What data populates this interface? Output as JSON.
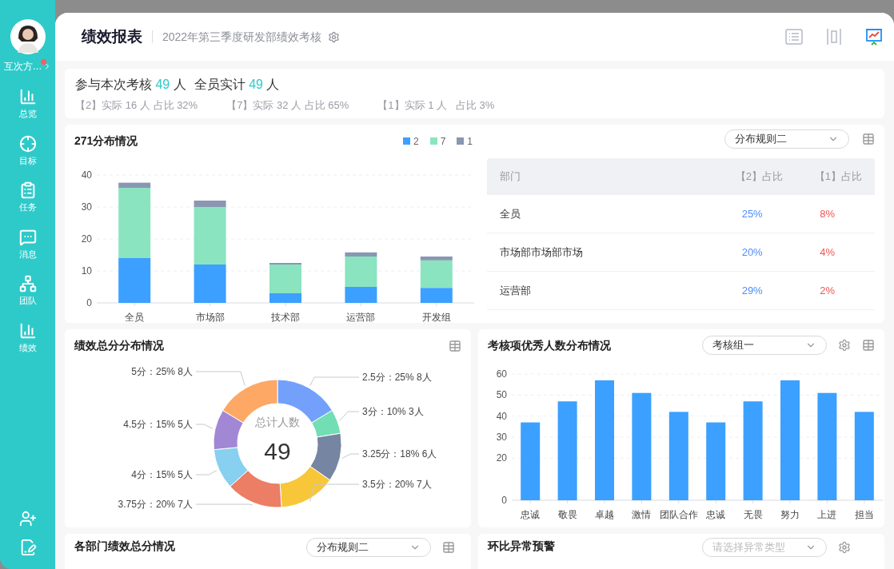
{
  "sidebar": {
    "user": {
      "name": "互次方…",
      "unread": true
    },
    "items": [
      {
        "label": "总览"
      },
      {
        "label": "目标"
      },
      {
        "label": "任务"
      },
      {
        "label": "消息"
      },
      {
        "label": "团队"
      },
      {
        "label": "绩效"
      }
    ]
  },
  "header": {
    "title": "绩效报表",
    "subtitle": "2022年第三季度研发部绩效考核",
    "views": [
      {
        "selected": false
      },
      {
        "selected": false
      },
      {
        "selected": true
      }
    ]
  },
  "summary": {
    "totals": [
      {
        "label": "参与本次考核",
        "count": "49",
        "unit": "人"
      },
      {
        "label": "全员实计",
        "count": "49",
        "unit": "人"
      }
    ],
    "breakdown": [
      "【2】实际 16 人 占比 32%",
      "【7】实际 32 人 占比 65%",
      "【1】实际 1 人   占比 3%"
    ]
  },
  "distribution": {
    "title": "271分布情况",
    "rule_select": {
      "value": "分布规则二"
    },
    "chart_data": {
      "type": "bar",
      "stacked": true,
      "grid": true,
      "categories": [
        "全员",
        "市场部",
        "技术部",
        "运营部",
        "开发组"
      ],
      "series": [
        {
          "name": "2",
          "color": "#3ba0ff",
          "values": [
            14,
            12,
            3,
            5,
            4.7
          ]
        },
        {
          "name": "7",
          "color": "#8ae4c0",
          "values": [
            22,
            18,
            9,
            9.5,
            8.6
          ]
        },
        {
          "name": "1",
          "color": "#8997b1",
          "values": [
            1.6,
            2,
            0.5,
            1.3,
            1.2
          ]
        }
      ],
      "ylim": [
        0,
        40
      ],
      "yticks": [
        0,
        10,
        20,
        30,
        40
      ]
    },
    "table": {
      "columns": [
        "部门",
        "【2】占比",
        "【1】占比"
      ],
      "rows": [
        [
          "全员",
          "25%",
          "8%"
        ],
        [
          "市场部市场部市场",
          "20%",
          "4%"
        ],
        [
          "运营部",
          "29%",
          "2%"
        ]
      ]
    }
  },
  "score_distribution": {
    "title": "绩效总分分布情况",
    "center_label": "总计人数",
    "center_value": "49",
    "chart_data": {
      "type": "donut",
      "categories": [
        "2.5分",
        "3分",
        "3.25分",
        "3.5分",
        "3.75分",
        "4分",
        "4.5分",
        "5分"
      ],
      "values": [
        8,
        3,
        6,
        7,
        7,
        5,
        5,
        8
      ],
      "colors": [
        "#73a0fa",
        "#73deb3",
        "#7585a2",
        "#f7c739",
        "#eb7e65",
        "#87d0ef",
        "#a287d4",
        "#fda864"
      ],
      "value_labels": [
        "：25%  8人",
        "：10%  3人",
        "：18%  6人",
        "：20%  7人",
        "：20%  7人",
        "：15%  5人",
        "：15%  5人",
        "：25%  8人"
      ]
    }
  },
  "excellent_distribution": {
    "title": "考核项优秀人数分布情况",
    "group_select": {
      "value": "考核组一"
    },
    "chart_data": {
      "type": "bar",
      "grid": true,
      "categories": [
        "忠诚",
        "敬畏",
        "卓越",
        "激情",
        "团队合作",
        "忠诚",
        "无畏",
        "努力",
        "上进",
        "担当"
      ],
      "series": [
        {
          "color": "#3ba0ff",
          "values": [
            37,
            47,
            57,
            51,
            42,
            37,
            47,
            57,
            51,
            42
          ]
        }
      ],
      "ylim": [
        0,
        60
      ],
      "yticks": [
        0,
        20,
        30,
        40,
        50,
        60
      ]
    }
  },
  "department_scores": {
    "title": "各部门绩效总分情况",
    "rule_select": {
      "value": "分布规则二"
    }
  },
  "anomaly_alert": {
    "title": "环比异常预警",
    "type_select": {
      "placeholder": "请选择异常类型"
    }
  }
}
